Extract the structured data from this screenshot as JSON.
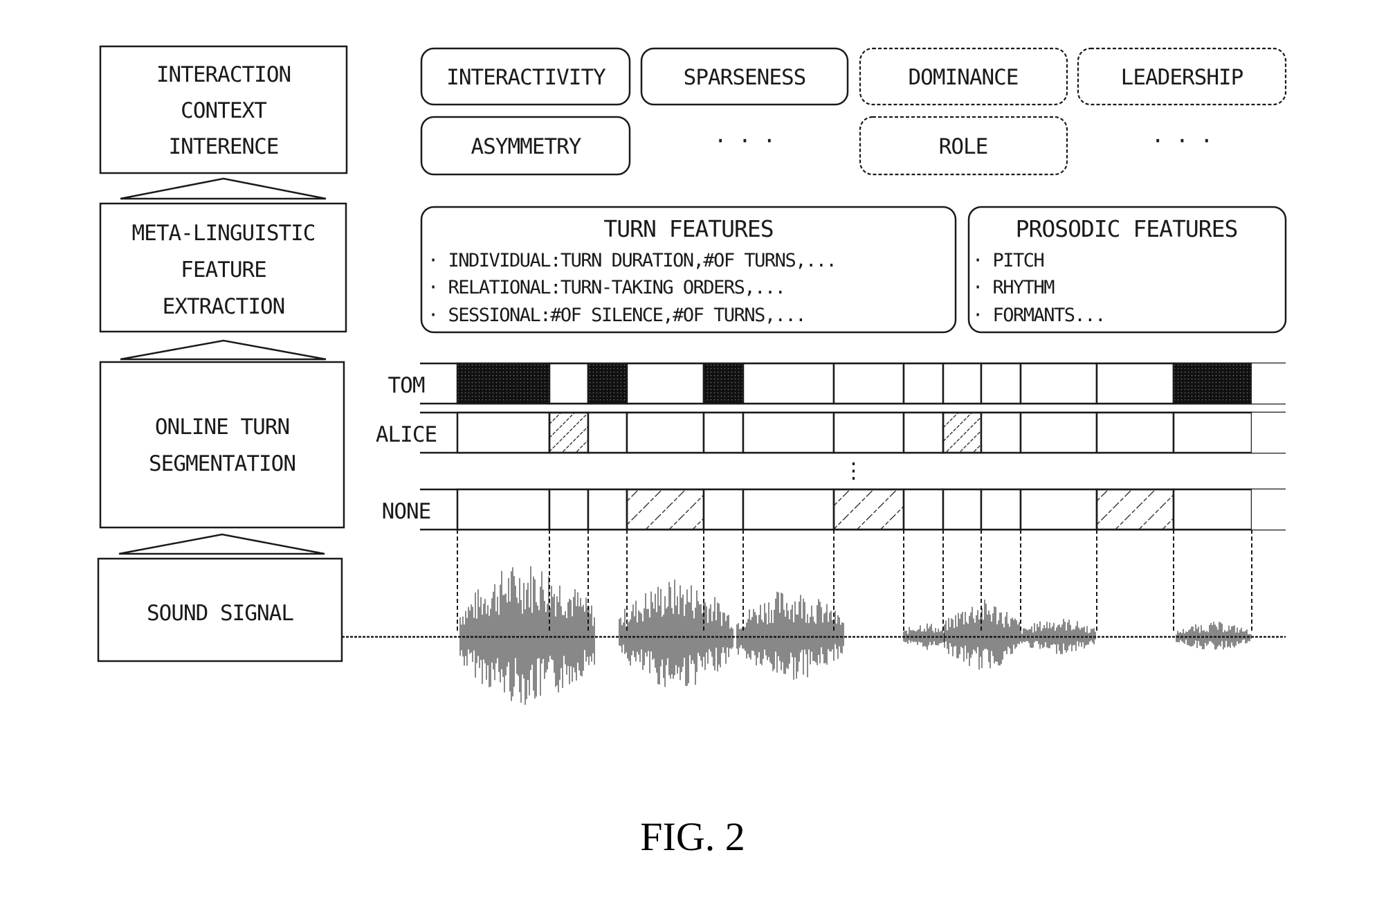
{
  "pipeline": {
    "stages": [
      {
        "id": "inference",
        "lines": [
          "INTERACTION",
          "CONTEXT",
          "INTERENCE"
        ]
      },
      {
        "id": "extraction",
        "lines": [
          "META-LINGUISTIC",
          "FEATURE",
          "EXTRACTION"
        ]
      },
      {
        "id": "segmentation",
        "lines": [
          "ONLINE TURN",
          "SEGMENTATION"
        ]
      },
      {
        "id": "sound",
        "lines": [
          "SOUND SIGNAL"
        ]
      }
    ]
  },
  "context_labels": {
    "row1": [
      "INTERACTIVITY",
      "SPARSENESS",
      "DOMINANCE",
      "LEADERSHIP"
    ],
    "row2": [
      "ASYMMETRY",
      "· · ·",
      "ROLE",
      "· · ·"
    ]
  },
  "features": {
    "turn": {
      "title": "TURN FEATURES",
      "items": [
        "· INDIVIDUAL:TURN DURATION,#OF TURNS,...",
        "· RELATIONAL:TURN-TAKING ORDERS,...",
        "· SESSIONAL:#OF SILENCE,#OF TURNS,..."
      ]
    },
    "prosodic": {
      "title": "PROSODIC FEATURES",
      "items": [
        "· PITCH",
        "· RHYTHM",
        "· FORMANTS..."
      ]
    }
  },
  "segmentation": {
    "segments": 14,
    "rows": [
      {
        "speaker": "TOM",
        "fill": "solid",
        "active": [
          0,
          2,
          4,
          12
        ]
      },
      {
        "speaker": "ALICE",
        "fill": "hatched",
        "active": [
          1,
          8
        ]
      },
      {
        "speaker": "NONE",
        "fill": "hatched",
        "active": [
          3,
          6,
          11
        ]
      }
    ],
    "ellipsis": "⋮"
  },
  "caption": "FIG. 2"
}
